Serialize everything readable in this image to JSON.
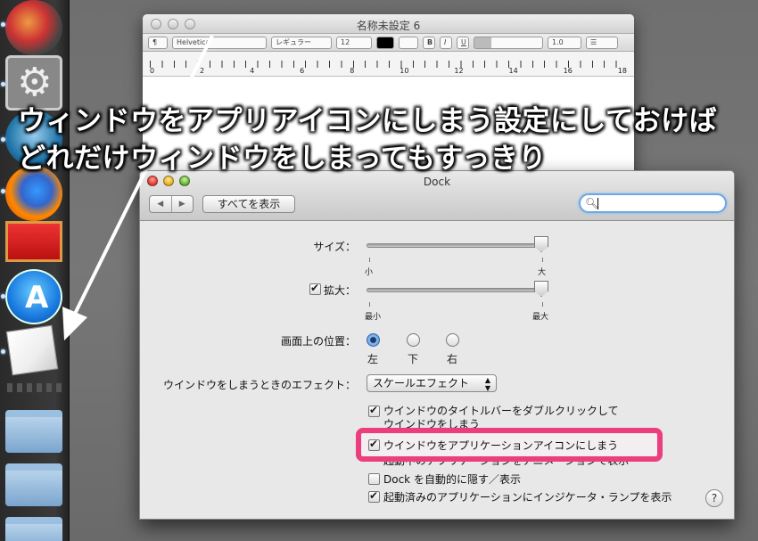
{
  "textedit": {
    "title": "名称未設定 6",
    "toolbar": {
      "paragraph": "¶",
      "font": "Helvetica",
      "style": "レギュラー",
      "size": "12",
      "bold": "B",
      "italic": "I",
      "underline": "U",
      "spacing": "1.0"
    },
    "ruler_numbers": [
      "0",
      "2",
      "4",
      "6",
      "8",
      "10",
      "12",
      "14",
      "16",
      "18"
    ]
  },
  "overlay": {
    "line1": "ウィンドウをアプリアイコンにしまう設定にしておけば",
    "line2": "どれだけウィンドウをしまってもすっきり"
  },
  "prefs": {
    "title": "Dock",
    "nav_back": "◀",
    "nav_forward": "▶",
    "show_all": "すべてを表示",
    "search_value": "",
    "size": {
      "label": "サイズ：",
      "min": "小",
      "max": "大",
      "value": 1.0
    },
    "magnify": {
      "label": "拡大：",
      "min": "最小",
      "max": "最大",
      "checked": true,
      "value": 1.0
    },
    "position": {
      "label": "画面上の位置：",
      "options": [
        "左",
        "下",
        "右"
      ],
      "selected": "左"
    },
    "effect": {
      "label": "ウインドウをしまうときのエフェクト：",
      "value": "スケールエフェクト"
    },
    "checkboxes": [
      {
        "label": "ウインドウのタイトルバーをダブルクリックして",
        "checked": true
      },
      {
        "label": "ウインドウをしまう",
        "checked": false
      },
      {
        "label": "ウインドウをアプリケーションアイコンにしまう",
        "checked": true
      },
      {
        "label": "起動中のアプリケーションをアニメーションで表示",
        "checked": false
      },
      {
        "label": "Dock を自動的に隠す／表示",
        "checked": false
      },
      {
        "label": "起動済みのアプリケーションにインジケータ・ランプを表示",
        "checked": true
      }
    ],
    "help": "?"
  },
  "colors": {
    "highlight": "#ec3d7c",
    "search_focus": "#6aa8e8"
  }
}
